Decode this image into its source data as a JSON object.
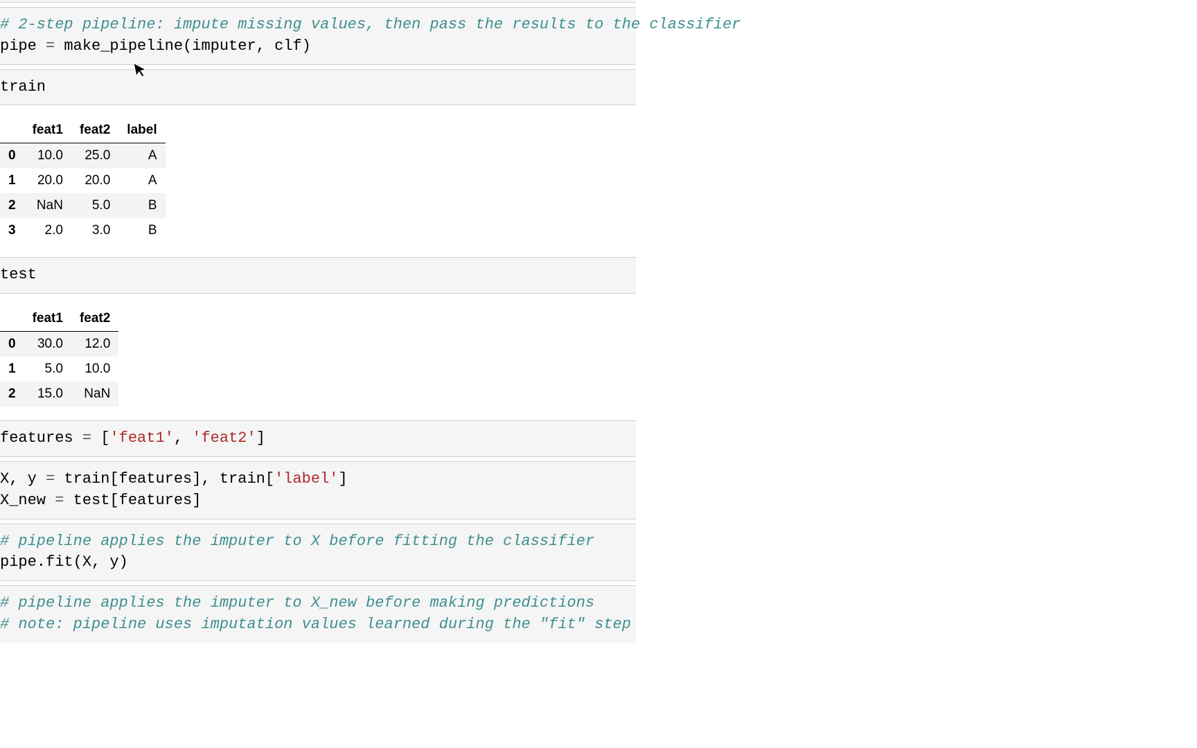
{
  "cells": {
    "c1": {
      "comment": "# 2-step pipeline: impute missing values, then pass the results to the classifier",
      "line2_a": "pipe ",
      "line2_eq": "=",
      "line2_b": " make_pipeline(imputer, clf)"
    },
    "c2": {
      "line": "train"
    },
    "train_table": {
      "headers": {
        "h0": "",
        "h1": "feat1",
        "h2": "feat2",
        "h3": "label"
      },
      "rows": [
        {
          "idx": "0",
          "f1": "10.0",
          "f2": "25.0",
          "lbl": "A"
        },
        {
          "idx": "1",
          "f1": "20.0",
          "f2": "20.0",
          "lbl": "A"
        },
        {
          "idx": "2",
          "f1": "NaN",
          "f2": "5.0",
          "lbl": "B"
        },
        {
          "idx": "3",
          "f1": "2.0",
          "f2": "3.0",
          "lbl": "B"
        }
      ]
    },
    "c3": {
      "line": "test"
    },
    "test_table": {
      "headers": {
        "h0": "",
        "h1": "feat1",
        "h2": "feat2"
      },
      "rows": [
        {
          "idx": "0",
          "f1": "30.0",
          "f2": "12.0"
        },
        {
          "idx": "1",
          "f1": "5.0",
          "f2": "10.0"
        },
        {
          "idx": "2",
          "f1": "15.0",
          "f2": "NaN"
        }
      ]
    },
    "c4": {
      "a": "features ",
      "eq": "=",
      "b": " [",
      "s1": "'feat1'",
      "c": ", ",
      "s2": "'feat2'",
      "d": "]"
    },
    "c5": {
      "l1a": "X, y ",
      "l1eq": "=",
      "l1b": " train[features], train[",
      "l1s": "'label'",
      "l1c": "]",
      "l2a": "X_new ",
      "l2eq": "=",
      "l2b": " test[features]"
    },
    "c6": {
      "comment": "# pipeline applies the imputer to X before fitting the classifier",
      "line": "pipe.fit(X, y)"
    },
    "c7": {
      "comment1": "# pipeline applies the imputer to X_new before making predictions",
      "comment2": "# note: pipeline uses imputation values learned during the \"fit\" step"
    }
  }
}
